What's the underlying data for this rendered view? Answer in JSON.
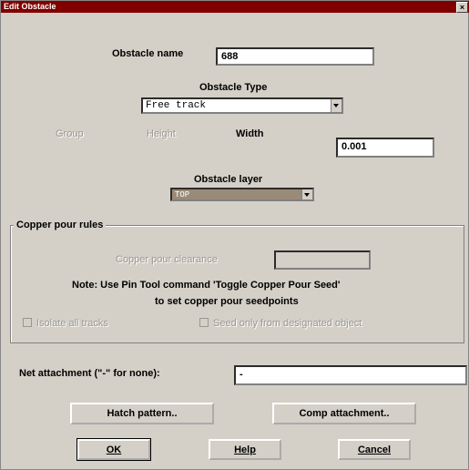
{
  "title": "Edit Obstacle",
  "close_glyph": "×",
  "obstacle_name": {
    "label": "Obstacle name",
    "value": "688"
  },
  "obstacle_type": {
    "label": "Obstacle Type",
    "value": "Free track"
  },
  "row_labels": {
    "group": "Group",
    "height": "Height",
    "width": "Width"
  },
  "width_value": "0.001",
  "obstacle_layer": {
    "label": "Obstacle layer",
    "value": "TOP"
  },
  "copper_pour": {
    "group_label": "Copper pour rules",
    "clearance_label": "Copper pour clearance",
    "clearance_value": "",
    "note_line1": "Note: Use Pin Tool command 'Toggle Copper Pour Seed'",
    "note_line2": "to set copper pour seedpoints",
    "isolate_label": "Isolate all tracks",
    "seed_label": "Seed only from designated object"
  },
  "net_attachment": {
    "label": "Net attachment (\"-\" for none):",
    "value": "-"
  },
  "buttons": {
    "hatch": "Hatch pattern..",
    "comp": "Comp attachment..",
    "ok": "OK",
    "help": "Help",
    "cancel": "Cancel"
  }
}
